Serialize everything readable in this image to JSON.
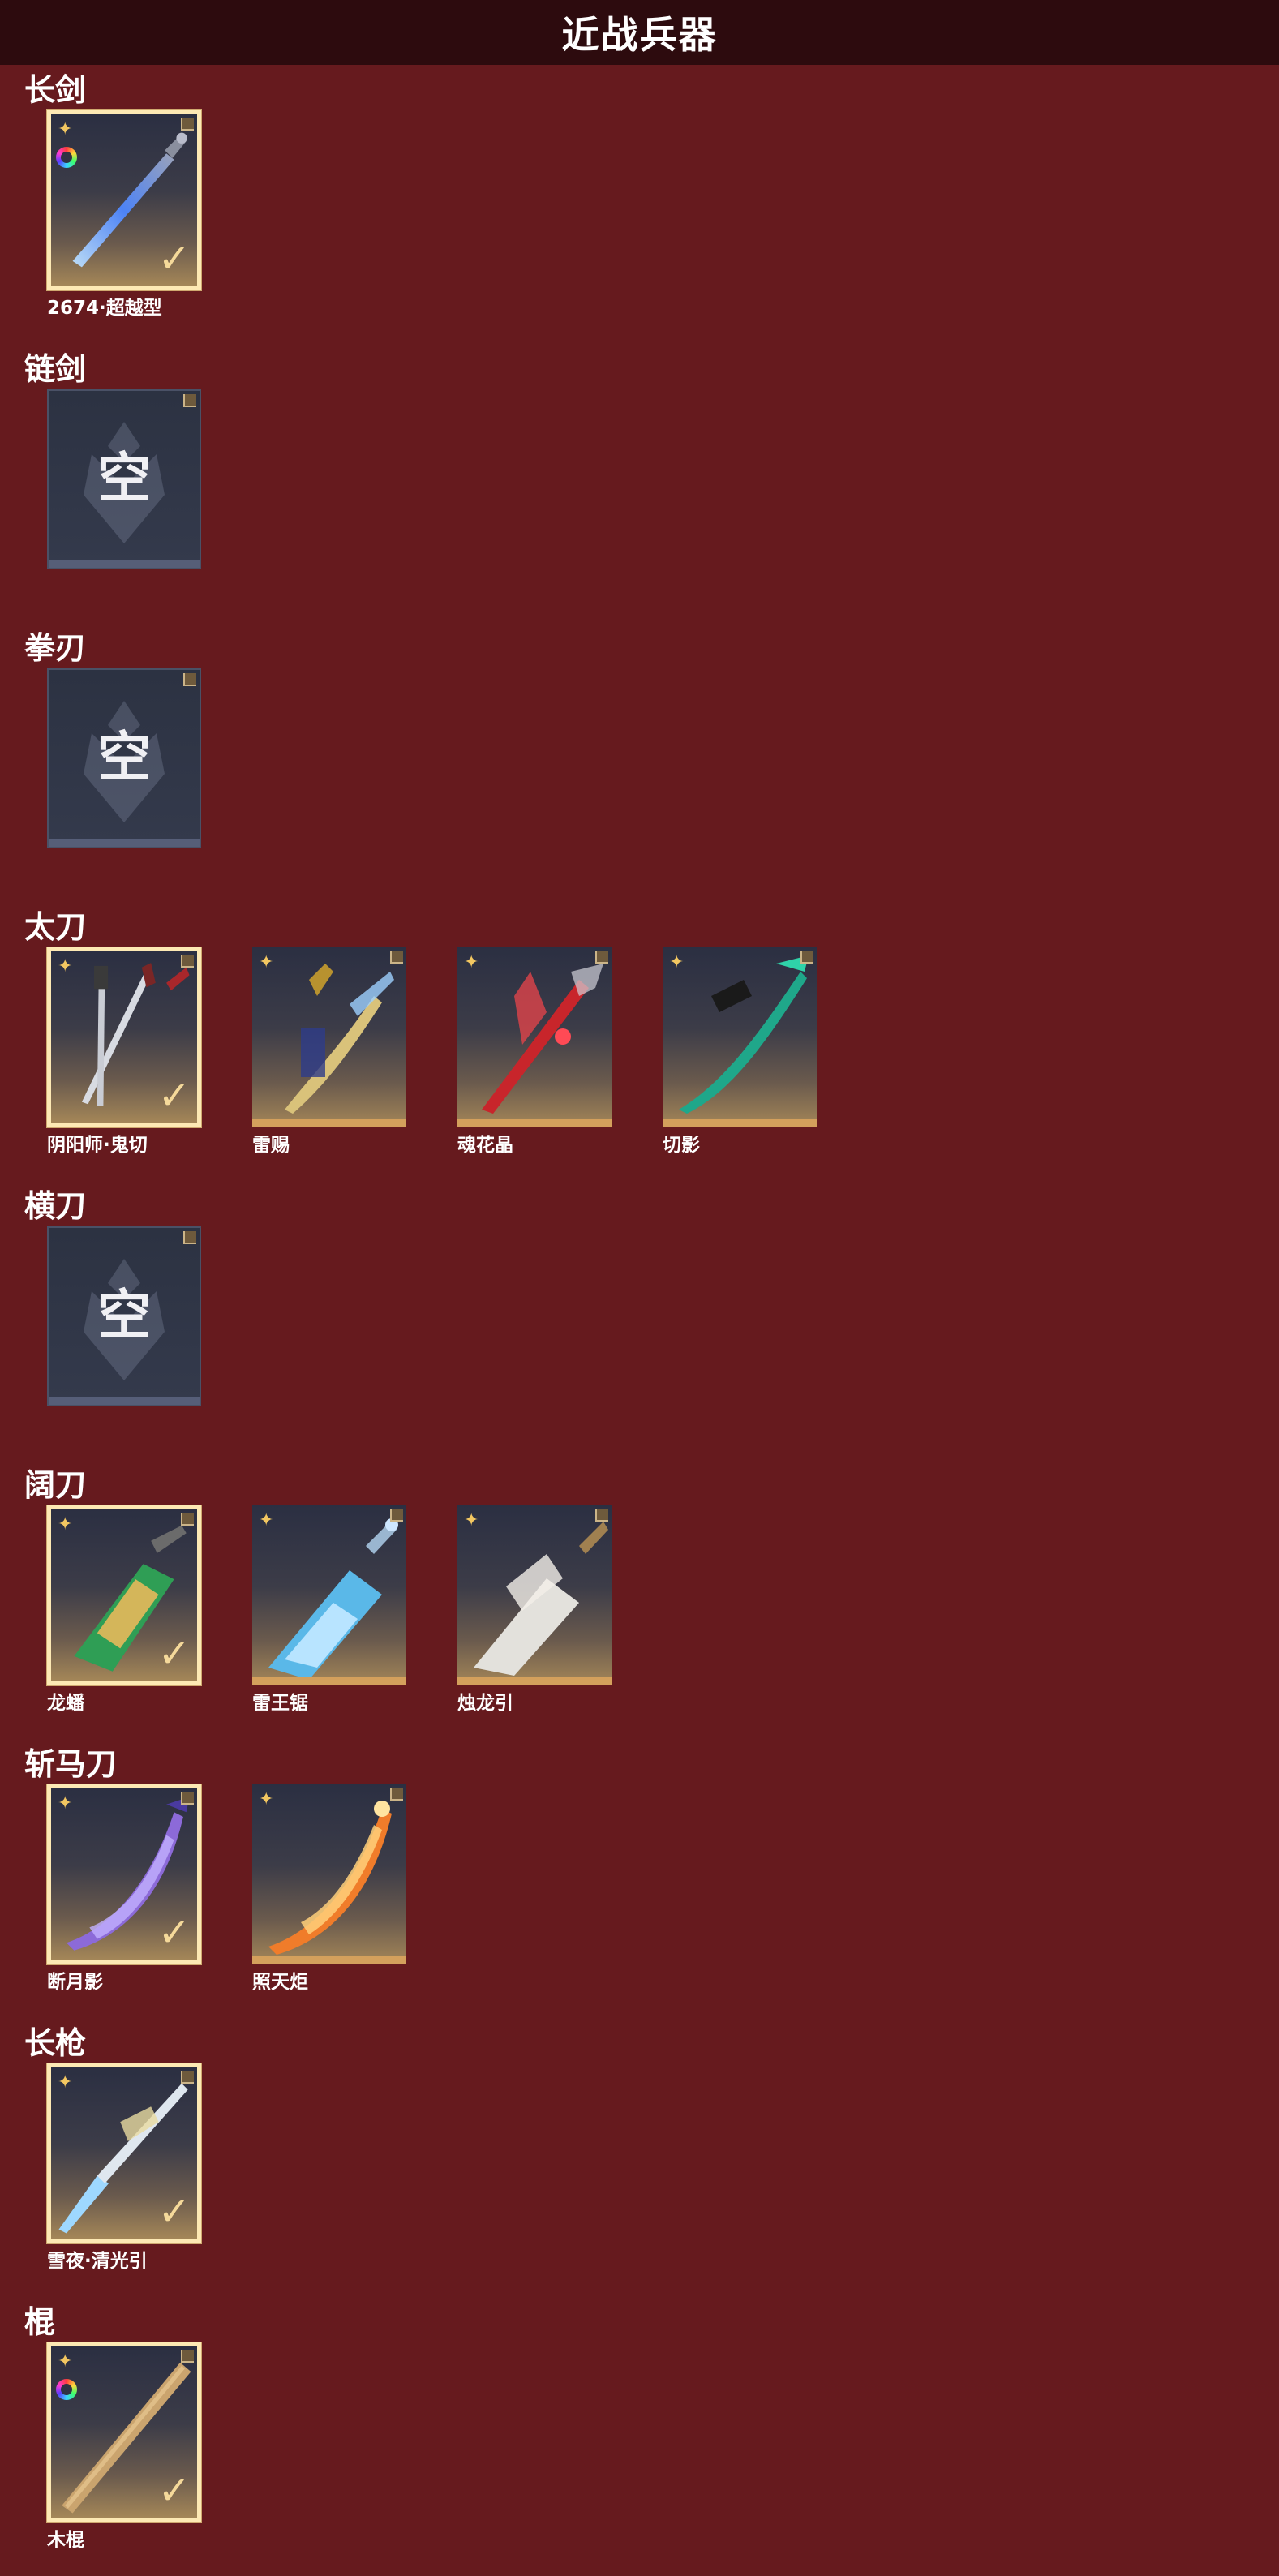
{
  "header": {
    "title": "近战兵器"
  },
  "sections": [
    {
      "title": "长剑",
      "items": [
        {
          "name": "2674·超越型",
          "state": "selected",
          "icon": "blue-sword",
          "ring": true
        }
      ]
    },
    {
      "title": "链剑",
      "items": [
        {
          "name": "",
          "state": "empty",
          "label": "空"
        }
      ]
    },
    {
      "title": "拳刃",
      "items": [
        {
          "name": "",
          "state": "empty",
          "label": "空"
        }
      ]
    },
    {
      "title": "太刀",
      "items": [
        {
          "name": "阴阳师·鬼切",
          "state": "selected",
          "icon": "twin-katana"
        },
        {
          "name": "雷赐",
          "state": "normal",
          "icon": "gold-blade"
        },
        {
          "name": "魂花晶",
          "state": "normal",
          "icon": "red-crystal-blade"
        },
        {
          "name": "切影",
          "state": "normal",
          "icon": "jade-blade"
        }
      ]
    },
    {
      "title": "横刀",
      "items": [
        {
          "name": "",
          "state": "empty",
          "label": "空"
        }
      ]
    },
    {
      "title": "阔刀",
      "items": [
        {
          "name": "龙蟠",
          "state": "selected",
          "icon": "green-broadsword"
        },
        {
          "name": "雷王锯",
          "state": "normal",
          "icon": "ice-broadsword"
        },
        {
          "name": "烛龙引",
          "state": "normal",
          "icon": "bone-broadsword"
        }
      ]
    },
    {
      "title": "斩马刀",
      "items": [
        {
          "name": "断月影",
          "state": "selected",
          "icon": "violet-glaive"
        },
        {
          "name": "照天炬",
          "state": "normal",
          "icon": "flame-glaive"
        }
      ]
    },
    {
      "title": "长枪",
      "items": [
        {
          "name": "雪夜·清光引",
          "state": "selected",
          "icon": "frost-spear"
        }
      ]
    },
    {
      "title": "棍",
      "items": [
        {
          "name": "木棍",
          "state": "selected",
          "icon": "wood-staff",
          "ring": true
        }
      ]
    }
  ],
  "icons": {
    "star": "✦",
    "check": "✓"
  },
  "colors": {
    "background": "#661a1e",
    "header": "#2d0b0e",
    "selected_border": "#fde9b4",
    "accent_gold": "#d4a05c",
    "empty_card": "#2c3242"
  }
}
